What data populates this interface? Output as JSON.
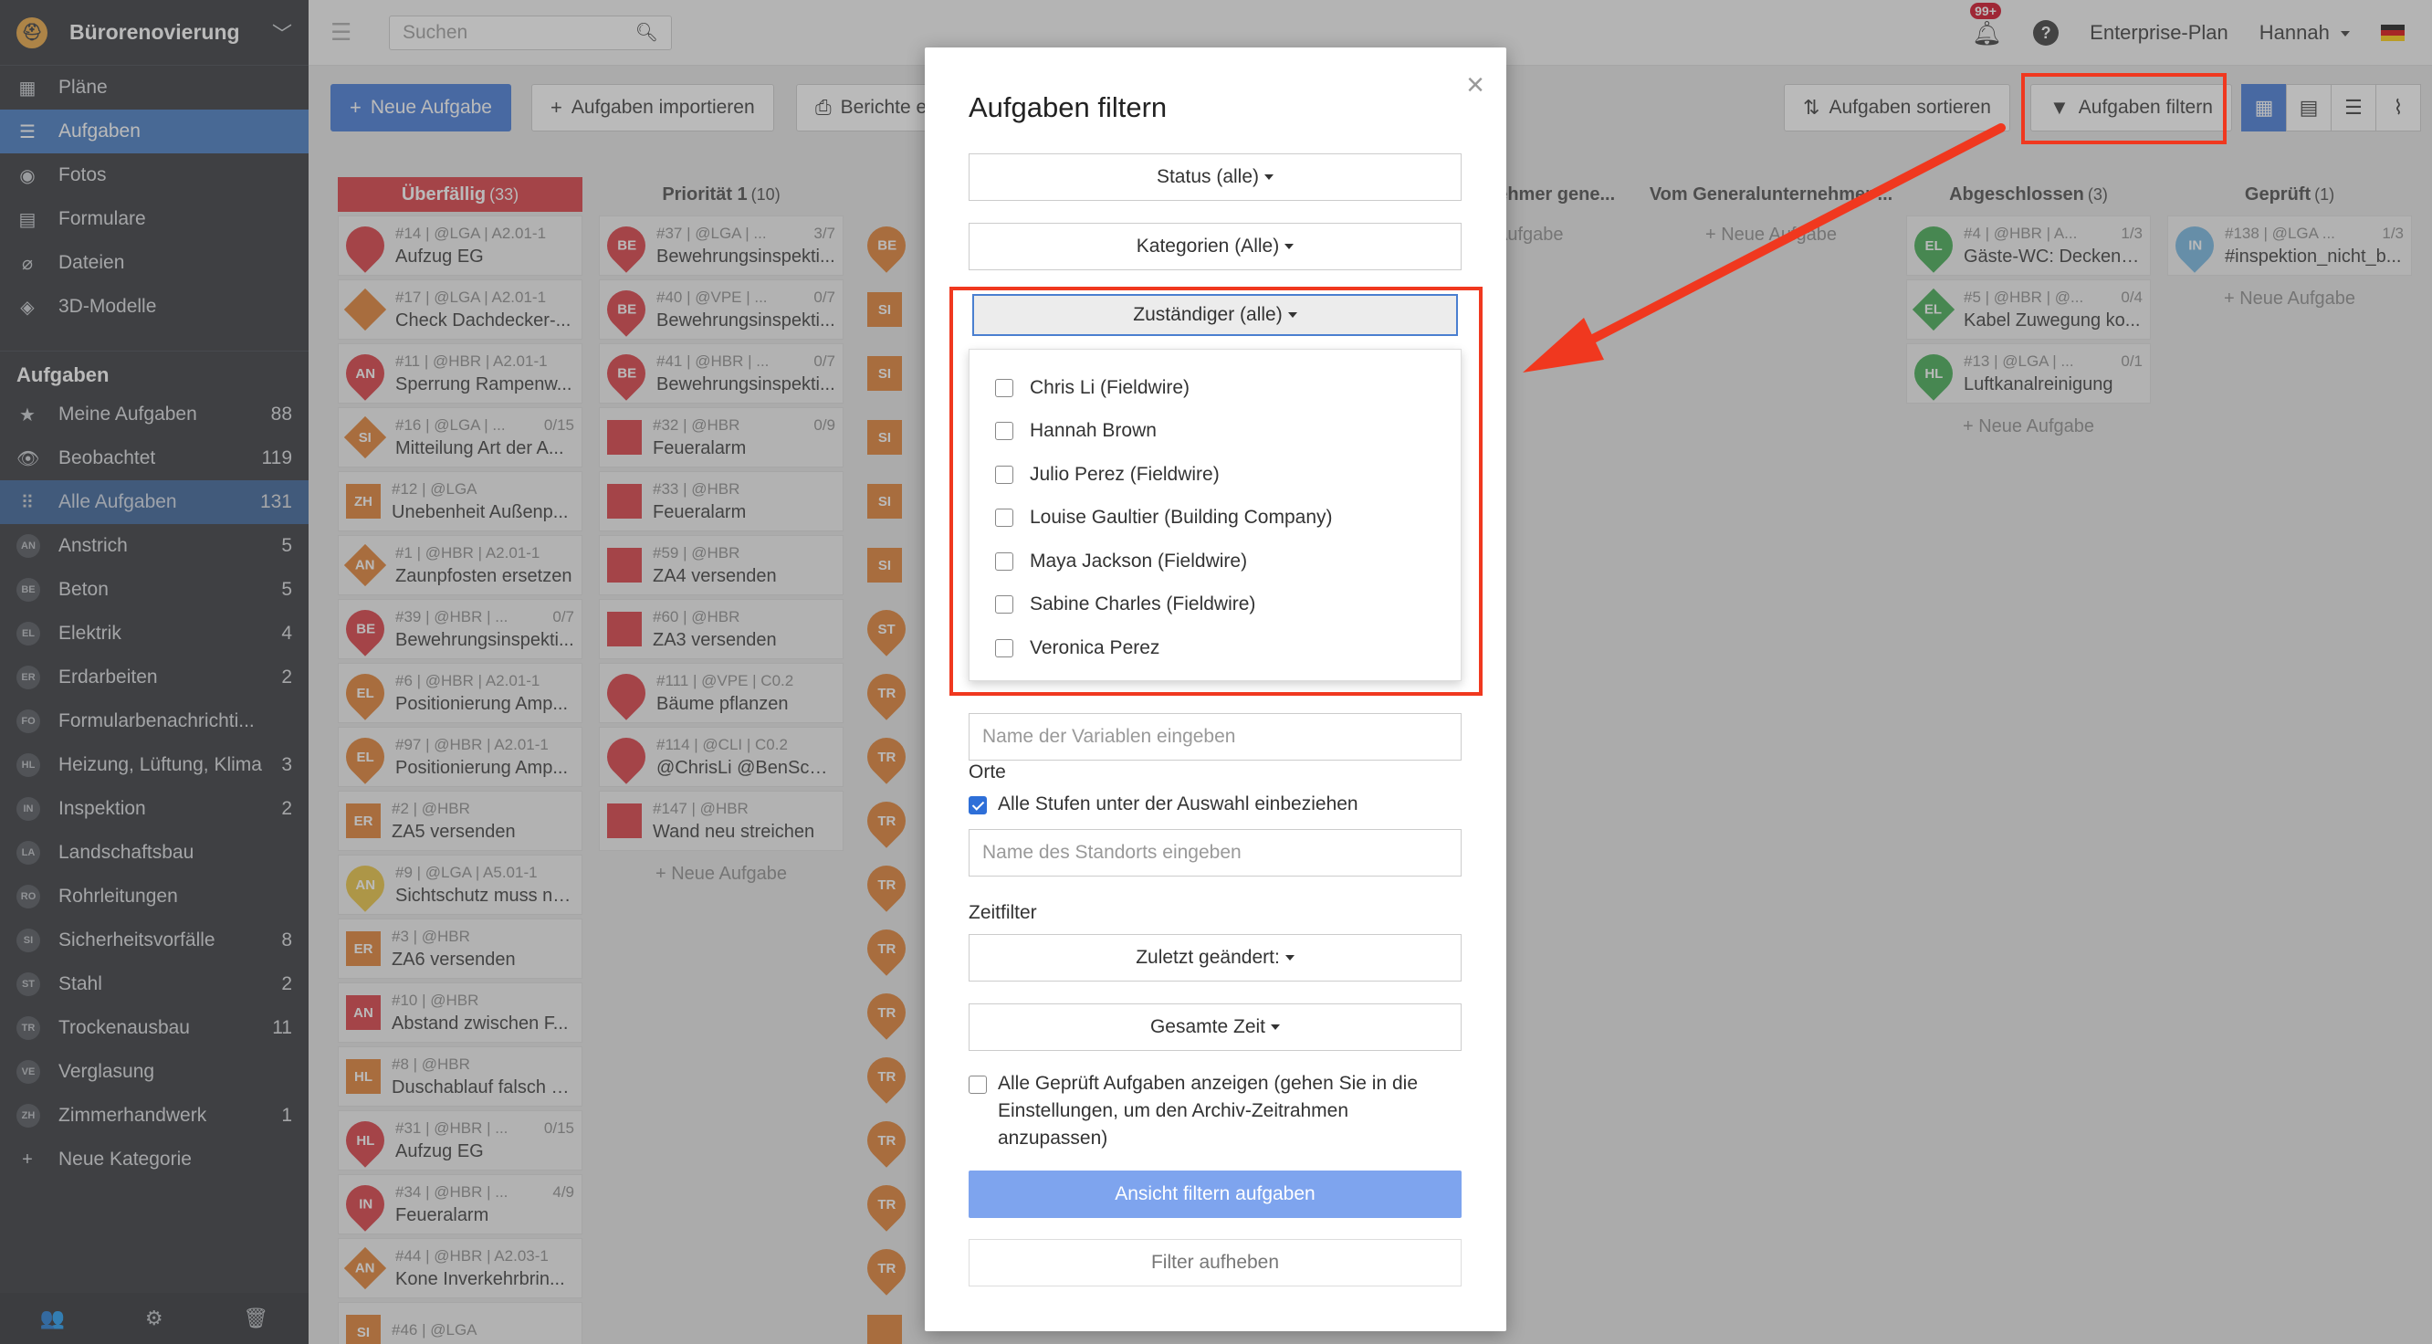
{
  "sidebar": {
    "project_name": "Bürorenovierung",
    "nav": [
      {
        "label": "Pläne",
        "icon": "map-icon"
      },
      {
        "label": "Aufgaben",
        "icon": "list-icon"
      },
      {
        "label": "Fotos",
        "icon": "camera-icon"
      },
      {
        "label": "Formulare",
        "icon": "clipboard-icon"
      },
      {
        "label": "Dateien",
        "icon": "paperclip-icon"
      },
      {
        "label": "3D-Modelle",
        "icon": "cube-icon"
      }
    ],
    "section_title": "Aufgaben",
    "filters": [
      {
        "label": "Meine Aufgaben",
        "count": "88",
        "icon": "star-icon"
      },
      {
        "label": "Beobachtet",
        "count": "119",
        "icon": "eye-icon"
      },
      {
        "label": "Alle Aufgaben",
        "count": "131",
        "icon": "grid-icon"
      }
    ],
    "categories": [
      {
        "abbr": "AN",
        "label": "Anstrich",
        "count": "5"
      },
      {
        "abbr": "BE",
        "label": "Beton",
        "count": "5"
      },
      {
        "abbr": "EL",
        "label": "Elektrik",
        "count": "4"
      },
      {
        "abbr": "ER",
        "label": "Erdarbeiten",
        "count": "2"
      },
      {
        "abbr": "FO",
        "label": "Formularbenachrichti...",
        "count": ""
      },
      {
        "abbr": "HL",
        "label": "Heizung, Lüftung, Klima",
        "count": "3"
      },
      {
        "abbr": "IN",
        "label": "Inspektion",
        "count": "2"
      },
      {
        "abbr": "LA",
        "label": "Landschaftsbau",
        "count": ""
      },
      {
        "abbr": "RO",
        "label": "Rohrleitungen",
        "count": ""
      },
      {
        "abbr": "SI",
        "label": "Sicherheitsvorfälle",
        "count": "8"
      },
      {
        "abbr": "ST",
        "label": "Stahl",
        "count": "2"
      },
      {
        "abbr": "TR",
        "label": "Trockenausbau",
        "count": "11"
      },
      {
        "abbr": "VE",
        "label": "Verglasung",
        "count": ""
      },
      {
        "abbr": "ZH",
        "label": "Zimmerhandwerk",
        "count": "1"
      }
    ],
    "new_category": "Neue Kategorie"
  },
  "header": {
    "search_placeholder": "Suchen",
    "notif_badge": "99+",
    "plan": "Enterprise-Plan",
    "user": "Hannah"
  },
  "toolbar": {
    "new_task": "Neue Aufgabe",
    "import_tasks": "Aufgaben importieren",
    "reports": "Berichte e",
    "sort_tasks": "Aufgaben sortieren",
    "filter_tasks": "Aufgaben filtern"
  },
  "board": {
    "add_task": "+ Neue Aufgabe",
    "columns": {
      "overdue": {
        "title": "Überfällig",
        "count": "(33)"
      },
      "prio1": {
        "title": "Priorität 1",
        "count": "(10)"
      },
      "sub_gen": {
        "title": "nehmer gene...",
        "count": ""
      },
      "from_gen": {
        "title": "Vom Generalunternehmer ...",
        "count": ""
      },
      "done": {
        "title": "Abgeschlossen",
        "count": "(3)"
      },
      "checked": {
        "title": "Geprüft",
        "count": "(1)"
      }
    },
    "overdue_cards": [
      {
        "meta": "#14 | @LGA | A2.01-1",
        "prog": "",
        "title": "Aufzug EG",
        "abbr": "",
        "shape": "pin",
        "color": "#d9343b"
      },
      {
        "meta": "#17 | @LGA | A2.01-1",
        "prog": "",
        "title": "Check Dachdecker-...",
        "abbr": "",
        "shape": "dia",
        "color": "#e07b2a"
      },
      {
        "meta": "#11 | @HBR | A2.01-1",
        "prog": "",
        "title": "Sperrung Rampenw...",
        "abbr": "AN",
        "shape": "pin",
        "color": "#d9343b"
      },
      {
        "meta": "#16 | @LGA | ...",
        "prog": "0/15",
        "title": "Mitteilung Art der A...",
        "abbr": "SI",
        "shape": "dia",
        "color": "#e07b2a"
      },
      {
        "meta": "#12 | @LGA",
        "prog": "",
        "title": "Unebenheit Außenp...",
        "abbr": "ZH",
        "shape": "sq",
        "color": "#e07b2a"
      },
      {
        "meta": "#1 | @HBR | A2.01-1",
        "prog": "",
        "title": "Zaunpfosten ersetzen",
        "abbr": "AN",
        "shape": "dia",
        "color": "#e07b2a"
      },
      {
        "meta": "#39 | @HBR | ...",
        "prog": "0/7",
        "title": "Bewehrungsinspekti...",
        "abbr": "BE",
        "shape": "pin",
        "color": "#d9343b"
      },
      {
        "meta": "#6 | @HBR | A2.01-1",
        "prog": "",
        "title": "Positionierung Amp...",
        "abbr": "EL",
        "shape": "pin",
        "color": "#e07b2a"
      },
      {
        "meta": "#97 | @HBR | A2.01-1",
        "prog": "",
        "title": "Positionierung Amp...",
        "abbr": "EL",
        "shape": "pin",
        "color": "#e07b2a"
      },
      {
        "meta": "#2 | @HBR",
        "prog": "",
        "title": "ZA5 versenden",
        "abbr": "ER",
        "shape": "sq",
        "color": "#e07b2a"
      },
      {
        "meta": "#9 | @LGA | A5.01-1",
        "prog": "",
        "title": "Sichtschutz muss na...",
        "abbr": "AN",
        "shape": "pin",
        "color": "#e8c13a"
      },
      {
        "meta": "#3 | @HBR",
        "prog": "",
        "title": "ZA6 versenden",
        "abbr": "ER",
        "shape": "sq",
        "color": "#e07b2a"
      },
      {
        "meta": "#10 | @HBR",
        "prog": "",
        "title": "Abstand zwischen F...",
        "abbr": "AN",
        "shape": "sq",
        "color": "#d9343b"
      },
      {
        "meta": "#8 | @HBR",
        "prog": "",
        "title": "Duschablauf falsch p...",
        "abbr": "HL",
        "shape": "sq",
        "color": "#e07b2a"
      },
      {
        "meta": "#31 | @HBR | ...",
        "prog": "0/15",
        "title": "Aufzug EG",
        "abbr": "HL",
        "shape": "pin",
        "color": "#d9343b"
      },
      {
        "meta": "#34 | @HBR | ...",
        "prog": "4/9",
        "title": "Feueralarm",
        "abbr": "IN",
        "shape": "pin",
        "color": "#d9343b"
      },
      {
        "meta": "#44 | @HBR | A2.03-1",
        "prog": "",
        "title": "Kone Inverkehrbrin...",
        "abbr": "AN",
        "shape": "dia",
        "color": "#e07b2a"
      },
      {
        "meta": "#46 | @LGA",
        "prog": "",
        "title": "",
        "abbr": "SI",
        "shape": "sq",
        "color": "#e07b2a"
      }
    ],
    "prio1_cards": [
      {
        "meta": "#37 | @LGA | ...",
        "prog": "3/7",
        "title": "Bewehrungsinspekti...",
        "abbr": "BE",
        "shape": "pin",
        "color": "#d9343b"
      },
      {
        "meta": "#40 | @VPE | ...",
        "prog": "0/7",
        "title": "Bewehrungsinspekti...",
        "abbr": "BE",
        "shape": "pin",
        "color": "#d9343b"
      },
      {
        "meta": "#41 | @HBR | ...",
        "prog": "0/7",
        "title": "Bewehrungsinspekti...",
        "abbr": "BE",
        "shape": "pin",
        "color": "#d9343b"
      },
      {
        "meta": "#32 | @HBR",
        "prog": "0/9",
        "title": "Feueralarm",
        "abbr": "",
        "shape": "sq",
        "color": "#d9343b"
      },
      {
        "meta": "#33 | @HBR",
        "prog": "",
        "title": "Feueralarm",
        "abbr": "",
        "shape": "sq",
        "color": "#d9343b"
      },
      {
        "meta": "#59 | @HBR",
        "prog": "",
        "title": "ZA4 versenden",
        "abbr": "",
        "shape": "sq",
        "color": "#d9343b"
      },
      {
        "meta": "#60 | @HBR",
        "prog": "",
        "title": "ZA3 versenden",
        "abbr": "",
        "shape": "sq",
        "color": "#d9343b"
      },
      {
        "meta": "#111 | @VPE | C0.2",
        "prog": "",
        "title": "Bäume pflanzen",
        "abbr": "",
        "shape": "pin",
        "color": "#d9343b"
      },
      {
        "meta": "#114 | @CLI | C0.2",
        "prog": "",
        "title": "@ChrisLi @BenScha...",
        "abbr": "",
        "shape": "pin",
        "color": "#d9343b"
      },
      {
        "meta": "#147 | @HBR",
        "prog": "",
        "title": "Wand neu streichen",
        "abbr": "",
        "shape": "sq",
        "color": "#d9343b"
      }
    ],
    "col3_markers": [
      {
        "abbr": "BE",
        "shape": "pin",
        "color": "#e07b2a"
      },
      {
        "abbr": "SI",
        "shape": "sq",
        "color": "#e07b2a"
      },
      {
        "abbr": "SI",
        "shape": "sq",
        "color": "#e07b2a"
      },
      {
        "abbr": "SI",
        "shape": "sq",
        "color": "#e07b2a"
      },
      {
        "abbr": "SI",
        "shape": "sq",
        "color": "#e07b2a"
      },
      {
        "abbr": "SI",
        "shape": "sq",
        "color": "#e07b2a"
      },
      {
        "abbr": "ST",
        "shape": "pin",
        "color": "#e07b2a"
      },
      {
        "abbr": "TR",
        "shape": "pin",
        "color": "#e07b2a"
      },
      {
        "abbr": "TR",
        "shape": "pin",
        "color": "#e07b2a"
      },
      {
        "abbr": "TR",
        "shape": "pin",
        "color": "#e07b2a"
      },
      {
        "abbr": "TR",
        "shape": "pin",
        "color": "#e07b2a"
      },
      {
        "abbr": "TR",
        "shape": "pin",
        "color": "#e07b2a"
      },
      {
        "abbr": "TR",
        "shape": "pin",
        "color": "#e07b2a"
      },
      {
        "abbr": "TR",
        "shape": "pin",
        "color": "#e07b2a"
      },
      {
        "abbr": "TR",
        "shape": "pin",
        "color": "#e07b2a"
      },
      {
        "abbr": "TR",
        "shape": "pin",
        "color": "#e07b2a"
      },
      {
        "abbr": "TR",
        "shape": "pin",
        "color": "#e07b2a"
      },
      {
        "abbr": "",
        "shape": "sq",
        "color": "#e07b2a"
      }
    ],
    "sub_gen_add": "Aufgabe",
    "done_cards": [
      {
        "meta": "#4 | @HBR | A...",
        "prog": "1/3",
        "title": "Gäste-WC: Deckens...",
        "abbr": "EL",
        "shape": "pin",
        "color": "#3aa84a"
      },
      {
        "meta": "#5 | @HBR | @...",
        "prog": "0/4",
        "title": "Kabel Zuwegung ko...",
        "abbr": "EL",
        "shape": "dia",
        "color": "#3aa84a"
      },
      {
        "meta": "#13 | @LGA | ...",
        "prog": "0/1",
        "title": "Luftkanalreinigung",
        "abbr": "HL",
        "shape": "pin",
        "color": "#3aa84a"
      }
    ],
    "checked_cards": [
      {
        "meta": "#138 | @LGA ...",
        "prog": "1/3",
        "title": "#inspektion_nicht_b...",
        "abbr": "IN",
        "shape": "pin",
        "color": "#6fb3e0"
      }
    ]
  },
  "modal": {
    "title": "Aufgaben filtern",
    "status": "Status (alle)",
    "categories": "Kategorien (Alle)",
    "assignee": "Zuständiger (alle)",
    "assignee_options": [
      "Chris Li (Fieldwire)",
      "Hannah Brown",
      "Julio Perez (Fieldwire)",
      "Louise Gaultier (Building Company)",
      "Maya Jackson (Fieldwire)",
      "Sabine Charles (Fieldwire)",
      "Veronica Perez"
    ],
    "variable_placeholder": "Name der Variablen eingeben",
    "locations_label": "Orte",
    "include_levels": "Alle Stufen unter der Auswahl einbeziehen",
    "location_placeholder": "Name des Standorts eingeben",
    "time_label": "Zeitfilter",
    "last_changed": "Zuletzt geändert:",
    "total_time": "Gesamte Zeit",
    "show_checked": "Alle Geprüft Aufgaben anzeigen (gehen Sie in die Einstellungen, um den Archiv-Zeitrahmen anzupassen)",
    "apply": "Ansicht filtern aufgaben",
    "clear": "Filter aufheben"
  },
  "colors": {
    "sidebar_bg": "#2b2e33",
    "accent": "#3c74d6",
    "highlight": "#f0381f",
    "overdue": "#d9343b"
  }
}
